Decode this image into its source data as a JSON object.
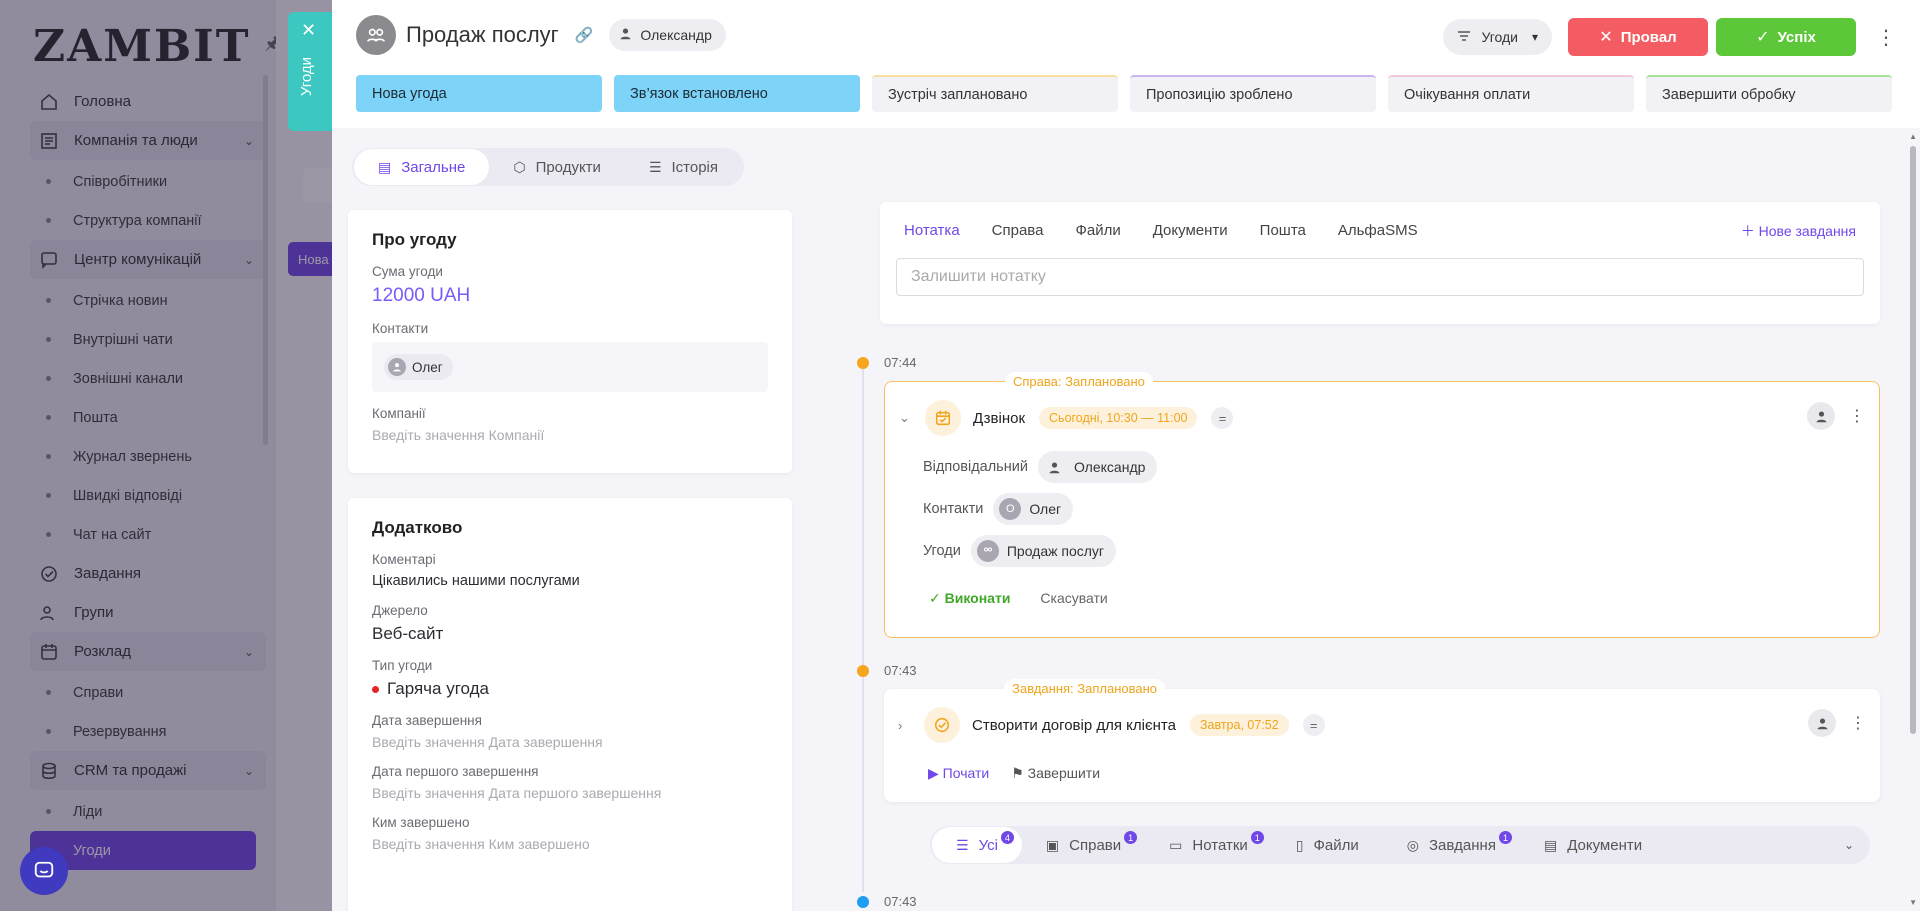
{
  "sidebar": {
    "logo": "ZAMBIT",
    "items": [
      {
        "label": "Головна",
        "type": "item",
        "icon": "home-icon"
      },
      {
        "label": "Компанія та люди",
        "type": "group",
        "icon": "company-icon"
      },
      {
        "label": "Співробітники",
        "type": "sub"
      },
      {
        "label": "Структура компанії",
        "type": "sub"
      },
      {
        "label": "Центр комунікацій",
        "type": "group",
        "icon": "communications-icon"
      },
      {
        "label": "Стрічка новин",
        "type": "sub"
      },
      {
        "label": "Внутрішні чати",
        "type": "sub"
      },
      {
        "label": "Зовнішні канали",
        "type": "sub"
      },
      {
        "label": "Пошта",
        "type": "sub"
      },
      {
        "label": "Журнал звернень",
        "type": "sub"
      },
      {
        "label": "Швидкі відповіді",
        "type": "sub"
      },
      {
        "label": "Чат на сайт",
        "type": "sub"
      },
      {
        "label": "Завдання",
        "type": "item",
        "icon": "task-check-icon"
      },
      {
        "label": "Групи",
        "type": "item",
        "icon": "groups-icon"
      },
      {
        "label": "Розклад",
        "type": "group",
        "icon": "calendar-icon"
      },
      {
        "label": "Справи",
        "type": "sub"
      },
      {
        "label": "Резервування",
        "type": "sub"
      },
      {
        "label": "CRM та продажі",
        "type": "group",
        "icon": "database-icon"
      },
      {
        "label": "Ліди",
        "type": "sub"
      },
      {
        "label": "Угоди",
        "type": "sub",
        "active": true
      }
    ],
    "bg_chip": "Нова"
  },
  "vertical_tab": {
    "label": "Угоди"
  },
  "header": {
    "title": "Продаж послуг",
    "owner": "Олександр",
    "filter_label": "Угоди",
    "fail_label": "Провал",
    "success_label": "Успіх"
  },
  "stages": [
    {
      "label": "Нова угода",
      "state": "done"
    },
    {
      "label": "Зв’язок встановлено",
      "state": "done"
    },
    {
      "label": "Зустріч заплановано",
      "state": "todo",
      "accent": "#f6dfa0"
    },
    {
      "label": "Пропозицію зроблено",
      "state": "todo",
      "accent": "#c9b6ee"
    },
    {
      "label": "Очікування оплати",
      "state": "todo",
      "accent": "#f2c9dc"
    },
    {
      "label": "Завершити обробку",
      "state": "todo",
      "accent": "#a8e39a"
    }
  ],
  "tabs": [
    {
      "label": "Загальне",
      "active": true
    },
    {
      "label": "Продукти"
    },
    {
      "label": "Історія"
    }
  ],
  "about": {
    "title": "Про угоду",
    "amount_label": "Сума угоди",
    "amount": "12000 UAH",
    "contacts_label": "Контакти",
    "contact_name": "Олег",
    "companies_label": "Компанії",
    "companies_placeholder": "Введіть значення Компанії"
  },
  "extra": {
    "title": "Додатково",
    "comments_label": "Коментарі",
    "comments_value": "Цікавились нашими послугами",
    "source_label": "Джерело",
    "source_value": "Веб-сайт",
    "type_label": "Тип угоди",
    "type_value": "Гаряча угода",
    "close_date_label": "Дата завершення",
    "close_date_placeholder": "Введіть значення Дата завершення",
    "first_close_label": "Дата першого завершення",
    "first_close_placeholder": "Введіть значення Дата першого завершення",
    "closed_by_label": "Ким завершено",
    "closed_by_placeholder": "Введіть значення Ким завершено"
  },
  "composer": {
    "tabs": [
      "Нотатка",
      "Справа",
      "Файли",
      "Документи",
      "Пошта",
      "АльфаSMS"
    ],
    "new_task": "Нове завдання",
    "placeholder": "Залишити нотатку"
  },
  "timeline": {
    "times": [
      "07:44",
      "07:43",
      "07:43"
    ],
    "event1": {
      "tag": "Справа: Заплановано",
      "title": "Дзвінок",
      "when": "Сьогодні, 10:30 — 11:00",
      "responsible_label": "Відповідальний",
      "responsible": "Олександр",
      "contacts_label": "Контакти",
      "contact": "Олег",
      "contact_initial": "О",
      "deals_label": "Угоди",
      "deal": "Продаж послуг",
      "done": "Виконати",
      "cancel": "Скасувати"
    },
    "event2": {
      "tag": "Завдання: Заплановано",
      "title": "Створити договір для клієнта",
      "when": "Завтра, 07:52",
      "start": "Почати",
      "finish": "Завершити"
    }
  },
  "filters": [
    {
      "label": "Усі",
      "badge": "4",
      "active": true
    },
    {
      "label": "Справи",
      "badge": "1"
    },
    {
      "label": "Нотатки",
      "badge": "1"
    },
    {
      "label": "Файли",
      "badge": ""
    },
    {
      "label": "Завдання",
      "badge": "1"
    },
    {
      "label": "Документи",
      "badge": ""
    }
  ],
  "colors": {
    "accent": "#7048e8",
    "stage_done": "#7dd3f8",
    "fail": "#f25c62",
    "success": "#5dc73a",
    "planned": "#f0a51c"
  }
}
